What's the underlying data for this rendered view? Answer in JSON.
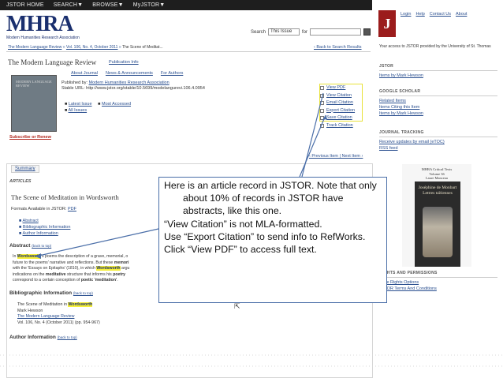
{
  "nav": {
    "items": [
      "JSTOR HOME",
      "SEARCH▼",
      "BROWSE▼",
      "MyJSTOR▼"
    ]
  },
  "logo": {
    "text": "MHRA",
    "subtitle": "Modern Humanities Research Association"
  },
  "search": {
    "label": "Search",
    "scope": "This Issue",
    "for_label": "for"
  },
  "breadcrumb": {
    "journal": "The Modern Language Review",
    "sep": "»",
    "issue": "Vol. 106, No. 4, October 2011",
    "article": "The Scene of Meditat...",
    "back": "‹ Back to Search Results"
  },
  "journal": {
    "title": "The Modern Language Review",
    "pub_info": "Publication Info",
    "tabs": [
      "About Journal",
      "News & Announcements",
      "For Authors"
    ]
  },
  "cover": {
    "text": "MODERN LANGUAGE REVIEW"
  },
  "subscribe": "Subscribe or Renew",
  "issue": {
    "published_by_label": "Published by:",
    "publisher": "Modern Humanities Research Association",
    "stable_url": "Stable URL: http://www.jstor.org/stable/10.5699/modelangurevi.106.4.0954",
    "latest": "Latest Issue",
    "most_accessed": "Most Accessed",
    "all_issues": "All Issues"
  },
  "tools": [
    "View PDF",
    "View Citation",
    "Email Citation",
    "Export Citation",
    "Save Citation",
    "Track Citation"
  ],
  "pager": "‹ Previous Item | Next Item ›",
  "summary_tab": "Summary",
  "articles_label": "ARTICLES",
  "article": {
    "title": "The Scene of Meditation in Wordsworth",
    "formats_label": "Formats Available in JSTOR:",
    "formats_value": "PDF",
    "links": [
      "Abstract",
      "Bibliographic Information",
      "Author Information"
    ]
  },
  "abstract": {
    "heading": "Abstract",
    "back": "(back to top)",
    "lines": [
      "In ",
      "Wordsworth",
      "'s poems the description of a grave, memorial, o",
      "future to the poems' narrative and reflections. But these ",
      "memori",
      "with the 'Essays on Epitaphs' (1810), in which ",
      "Wordsworth",
      " argu",
      "indications on the ",
      "meditative",
      " structure that informs his ",
      "poetry",
      "correspond to a certain conception of ",
      "poetic 'meditation'",
      "."
    ]
  },
  "bib": {
    "heading": "Bibliographic Information",
    "back": "(back to top)",
    "title_pre": "The Scene of Meditation in ",
    "title_hl": "Wordsworth",
    "author": "Mark Hewson",
    "journal": "The Modern Language Review",
    "vol": "Vol. 106, No. 4 (October 2011) (pp. 954-967)"
  },
  "author_info": {
    "heading": "Author Information",
    "back": "(back to top)"
  },
  "right": {
    "top_links": [
      "Login",
      "Help",
      "Contact Us",
      "About"
    ],
    "jstor_letter": "J",
    "jstor_word": "JSTOR",
    "access": "Your access to JSTOR provided by the University of St. Thomas",
    "jstor_head": "JSTOR",
    "jstor_items": [
      "Items by Mark Hewson"
    ],
    "scholar_head": "GOOGLE SCHOLAR",
    "scholar_items": [
      "Related Items",
      "Items Citing this Item",
      "Items by Mark Hewson"
    ],
    "tracking_head": "JOURNAL TRACKING",
    "tracking_items": [
      "Receive updates by email (eTOC)",
      "RSS feed"
    ],
    "book_header": "MHRA Critical Texts\nVolume 36\nLaure Manceau",
    "book_title": "Joséphine de Monbart\nLettres taïtiennes",
    "rights_head": "RIGHTS AND PERMISSIONS",
    "rights_items": [
      "More Rights Options",
      "JSTOR Terms And Conditions"
    ]
  },
  "callout": {
    "lines": [
      "Here is an article record in JSTOR. Note that only about 10% of records in JSTOR have abstracts, like this one.",
      "“View Citation” is not MLA-formatted.",
      "Use “Export Citation” to send info to RefWorks.",
      "Click “View PDF” to access full text."
    ]
  }
}
